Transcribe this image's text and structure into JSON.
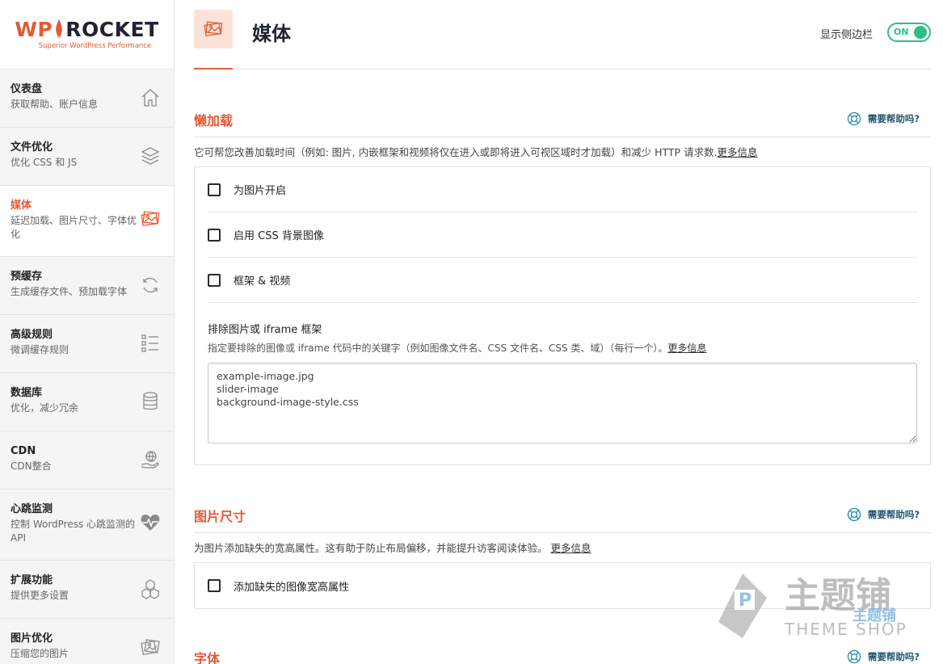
{
  "logo": {
    "brand_left": "WP",
    "brand_right": "ROCKET",
    "tagline": "Superior WordPress Performance"
  },
  "sidebar": {
    "items": [
      {
        "title": "仪表盘",
        "desc": "获取帮助、账户信息",
        "icon": "home-icon"
      },
      {
        "title": "文件优化",
        "desc": "优化 CSS 和 JS",
        "icon": "layers-icon"
      },
      {
        "title": "媒体",
        "desc": "延迟加载、图片尺寸、字体优化",
        "icon": "images-icon",
        "active": true
      },
      {
        "title": "预缓存",
        "desc": "生成缓存文件、预加载字体",
        "icon": "refresh-icon"
      },
      {
        "title": "高级规则",
        "desc": "微调缓存规则",
        "icon": "list-icon"
      },
      {
        "title": "数据库",
        "desc": "优化，减少冗余",
        "icon": "database-icon"
      },
      {
        "title": "CDN",
        "desc": "CDN整合",
        "icon": "globe-hand-icon"
      },
      {
        "title": "心跳监测",
        "desc": "控制 WordPress 心跳监测的 API",
        "icon": "heartbeat-icon"
      },
      {
        "title": "扩展功能",
        "desc": "提供更多设置",
        "icon": "cubes-icon"
      },
      {
        "title": "图片优化",
        "desc": "压缩您的图片",
        "icon": "photos-icon"
      }
    ]
  },
  "header": {
    "title": "媒体",
    "sidebar_toggle_label": "显示侧边栏",
    "toggle_state": "ON"
  },
  "sections": {
    "lazyload": {
      "title": "懒加载",
      "help": "需要帮助吗?",
      "desc": "它可帮您改善加载时间（例如: 图片, 内嵌框架和视频将仅在进入或即将进入可视区域时才加载）和减少 HTTP 请求数.",
      "more": "更多信息",
      "options": [
        "为图片开启",
        "启用 CSS 背景图像",
        "框架 & 视频"
      ],
      "exclude_label": "排除图片或 iframe 框架",
      "exclude_desc": "指定要排除的图像或 iframe 代码中的关键字（例如图像文件名、CSS 文件名、CSS 类、域）（每行一个）。",
      "exclude_more": "更多信息",
      "exclude_value": "example-image.jpg\nslider-image\nbackground-image-style.css"
    },
    "dimensions": {
      "title": "图片尺寸",
      "help": "需要帮助吗?",
      "desc": "为图片添加缺失的宽高属性。这有助于防止布局偏移，并能提升访客阅读体验。 ",
      "more": "更多信息",
      "options": [
        "添加缺失的图像宽高属性"
      ]
    },
    "fonts": {
      "title": "字体",
      "help": "需要帮助吗?"
    }
  },
  "watermark": {
    "text_cn": "主题铺",
    "text_en": "THEME SHOP",
    "small": "主题铺"
  },
  "colors": {
    "accent": "#e35b35",
    "toggle": "#2ebd86",
    "help": "#1f5470"
  }
}
